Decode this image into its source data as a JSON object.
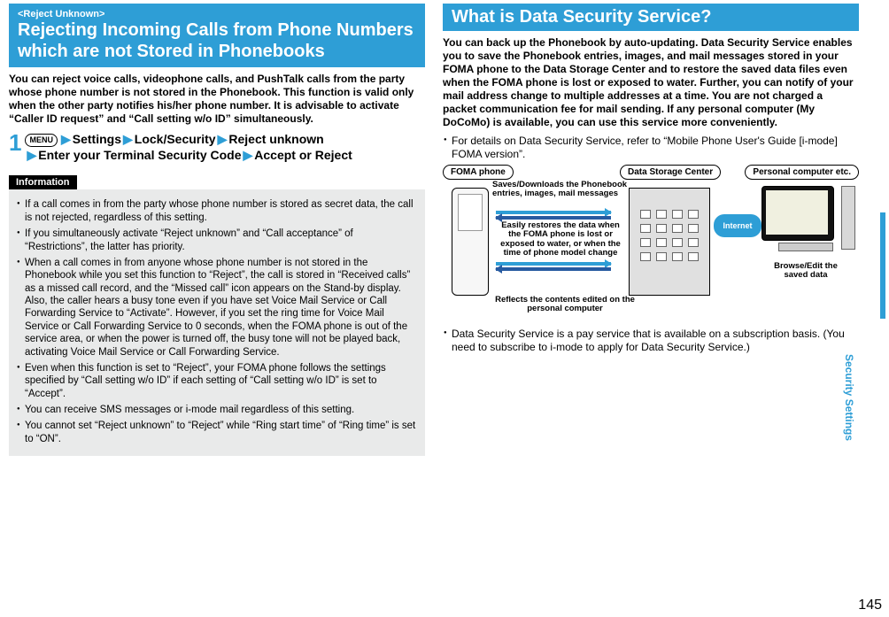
{
  "sideLabel": "Security Settings",
  "pageNumber": "145",
  "left": {
    "headerTag": "<Reject Unknown>",
    "headerTitle": "Rejecting Incoming Calls from Phone Numbers which are not Stored in Phonebooks",
    "intro": "You can reject voice calls, videophone calls, and PushTalk calls from the party whose phone number is not stored in the Phonebook.\nThis function is valid only when the other party notifies his/her phone number. It is advisable to activate “Caller ID request” and “Call setting w/o ID” simultaneously.",
    "step": {
      "num": "1",
      "menu": "MENU",
      "parts": [
        "Settings",
        "Lock/Security",
        "Reject unknown"
      ],
      "line2a": "Enter your Terminal Security Code",
      "line2b": "Accept or Reject"
    },
    "infoHeader": "Information",
    "info": [
      "If a call comes in from the party whose phone number is stored as secret data, the call is not rejected, regardless of this setting.",
      "If you simultaneously activate “Reject unknown” and “Call acceptance” of “Restrictions”, the latter has priority.",
      "When a call comes in from anyone whose phone number is not stored in the Phonebook while you set this function to “Reject”, the call is stored in “Received calls” as a missed call record, and the “Missed call” icon appears on the Stand-by display. Also, the caller hears a busy tone even if you have set Voice Mail Service or Call Forwarding Service to “Activate”. However, if you set the ring time for Voice Mail Service or Call Forwarding Service to 0 seconds, when the FOMA phone is out of the service area, or when the power is turned off, the busy tone will not be played back, activating Voice Mail Service or Call Forwarding Service.",
      "Even when this function is set to “Reject”, your FOMA phone follows the settings specified by “Call setting w/o ID” if each setting of “Call setting w/o ID” is set to “Accept”.",
      "You can receive SMS messages or i-mode mail regardless of this setting.",
      "You cannot set “Reject unknown” to “Reject” while “Ring start time” of “Ring time” is set to “ON”."
    ]
  },
  "right": {
    "headerTitle": "What is Data Security Service?",
    "intro": "You can back up the Phonebook by auto-updating. Data Security Service enables you to save the Phonebook entries, images, and mail messages stored in your FOMA phone to the Data Storage Center and to restore the saved data files even when the FOMA phone is lost or exposed to water. Further, you can notify of your mail address change to multiple addresses at a time. You are not charged a packet communication fee for mail sending. If any personal computer (My DoCoMo) is available, you can use this service more conveniently.",
    "bullets1": [
      "For details on Data Security Service, refer to “Mobile Phone User's Guide [i-mode] FOMA version”."
    ],
    "diagram": {
      "chipPhone": "FOMA phone",
      "chipCenter": "Data Storage Center",
      "chipPc": "Personal computer etc.",
      "txtSaves": "Saves/Downloads the Phonebook entries, images, mail messages",
      "txtRestores": "Easily restores the data when the FOMA phone is lost or exposed to water, or when the time of phone model change",
      "txtReflects": "Reflects the contents edited on the personal computer",
      "internet": "Internet",
      "txtBrowse": "Browse/Edit the saved data"
    },
    "bullets2": [
      "Data Security Service is a pay service that is available on a subscription basis. (You need to subscribe to i-mode to apply for Data Security Service.)"
    ]
  }
}
